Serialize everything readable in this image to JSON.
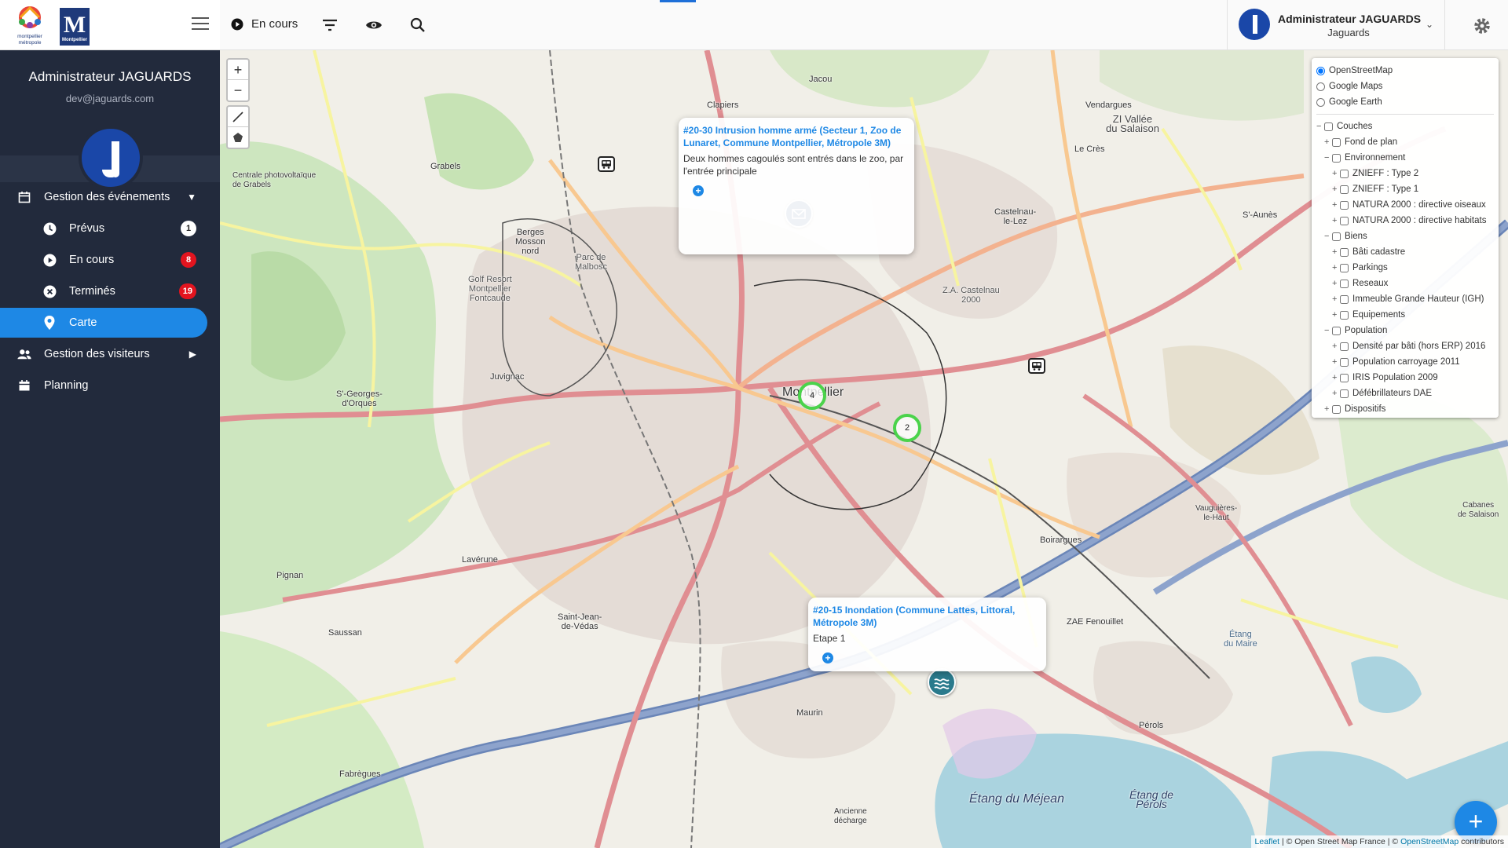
{
  "sidebar": {
    "logo_city_text": "Montpellier Méditerranée Métropole",
    "logo_m_letter": "M",
    "logo_m_caption": "Montpellier",
    "profile_name": "Administrateur JAGUARDS",
    "profile_email": "dev@jaguards.com",
    "nav": {
      "events": "Gestion des événements",
      "planned": "Prévus",
      "planned_count": "1",
      "ongoing": "En cours",
      "ongoing_count": "8",
      "finished": "Terminés",
      "finished_count": "19",
      "map": "Carte",
      "visitors": "Gestion des visiteurs",
      "planning": "Planning"
    }
  },
  "topbar": {
    "status_label": "En cours",
    "user_name": "Administrateur JAGUARDS",
    "user_org": "Jaguards"
  },
  "map": {
    "places": {
      "jacou": "Jacou",
      "clapiers": "Clapiers",
      "vendargues": "Vendargues",
      "zi_vallee": "ZI Vallée\ndu Salaison",
      "le_cres": "Le Crès",
      "grabels": "Grabels",
      "castelnau": "Castelnau-\nle-Lez",
      "st_aunes": "S'-Aunès",
      "centrale": "Centrale photovoltaïque\nde Grabels",
      "berges": "Berges\nMosson\nnord",
      "parc_malbosc": "Parc de\nMalbosc",
      "golf": "Golf Resort\nMontpellier\nFontcaude",
      "za_castelnau": "Z.A. Castelnau\n2000",
      "juvignac": "Juvignac",
      "st_georges": "S'-Georges-\nd'Orques",
      "montpellier": "Montpellier",
      "laverune": "Lavérune",
      "pignan": "Pignan",
      "boirargues": "Boirargues",
      "vauguieres": "Vauguières-\nle-Haut",
      "saint_jean": "Saint-Jean-\nde-Védas",
      "saussan": "Saussan",
      "za_fenouillet": "ZAE Fenouillet",
      "etang_maire": "Étang\ndu Maire",
      "cabanes": "Cabanes\nde Salaison",
      "maurin": "Maurin",
      "perols": "Pérols",
      "fabregues": "Fabrègues",
      "etang_mejean": "Étang du Méjean",
      "etang_perols": "Étang de\nPérols",
      "ancienne": "Ancienne\ndécharge"
    },
    "popups": [
      {
        "title": "#20-30 Intrusion homme armé (Secteur 1, Zoo de Lunaret, Commune Montpellier, Métropole 3M)",
        "description": "Deux hommes cagoulés sont entrés dans le zoo, par l'entrée principale"
      },
      {
        "title": "#20-15 Inondation (Commune Lattes, Littoral, Métropole 3M)",
        "description": "Etape 1"
      }
    ],
    "clusters": [
      "4",
      "2"
    ],
    "colors": {
      "accent": "#1e88e5",
      "cluster_ring": "#4bd34b",
      "marker_dark": "#1f4f7a",
      "marker_water": "#2a7a8c",
      "badge_red": "#e3141f"
    }
  },
  "layers": {
    "base": [
      "OpenStreetMap",
      "Google Maps",
      "Google Earth"
    ],
    "base_selected": "OpenStreetMap",
    "root": "Couches",
    "fond": "Fond de plan",
    "env": "Environnement",
    "env_items": [
      "ZNIEFF : Type 2",
      "ZNIEFF : Type 1",
      "NATURA 2000 : directive oiseaux",
      "NATURA 2000 : directive habitats"
    ],
    "biens": "Biens",
    "biens_items": [
      "Bâti cadastre",
      "Parkings",
      "Reseaux",
      "Immeuble Grande Hauteur (IGH)",
      "Equipements"
    ],
    "population": "Population",
    "population_items": [
      "Densité par bâti (hors ERP) 2016",
      "Population carroyage 2011",
      "IRIS Population 2009",
      "Défébrillateurs DAE"
    ],
    "dispositifs": "Dispositifs"
  },
  "attribution": {
    "leaflet": "Leaflet",
    "osm_france": " | © Open Street Map France | © ",
    "osm": "OpenStreetMap",
    "contributors": " contributors"
  },
  "fab_label": "+"
}
